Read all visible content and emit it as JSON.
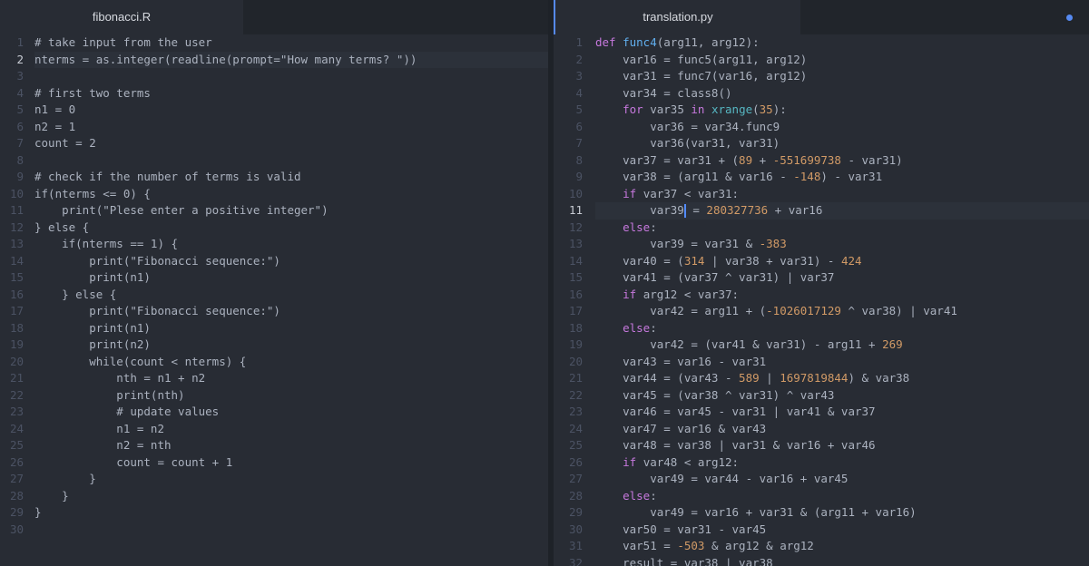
{
  "colors": {
    "background": "#282c34",
    "tabbar": "#21252b",
    "accent": "#568af2",
    "text": "#abb2bf",
    "keyword": "#c678dd",
    "function": "#61afef",
    "number": "#d19a66",
    "builtin": "#56b6c2",
    "line_number": "#4b5263"
  },
  "left": {
    "tab_title": "fibonacci.R",
    "line_numbers": [
      "1",
      "2",
      "3",
      "4",
      "5",
      "6",
      "7",
      "8",
      "9",
      "10",
      "11",
      "12",
      "13",
      "14",
      "15",
      "16",
      "17",
      "18",
      "19",
      "20",
      "21",
      "22",
      "23",
      "24",
      "25",
      "26",
      "27",
      "28",
      "29",
      "30"
    ],
    "lines": [
      "# take input from the user",
      "nterms = as.integer(readline(prompt=\"How many terms? \"))",
      "",
      "# first two terms",
      "n1 = 0",
      "n2 = 1",
      "count = 2",
      "",
      "# check if the number of terms is valid",
      "if(nterms <= 0) {",
      "    print(\"Plese enter a positive integer\")",
      "} else {",
      "    if(nterms == 1) {",
      "        print(\"Fibonacci sequence:\")",
      "        print(n1)",
      "    } else {",
      "        print(\"Fibonacci sequence:\")",
      "        print(n1)",
      "        print(n2)",
      "        while(count < nterms) {",
      "            nth = n1 + n2",
      "            print(nth)",
      "            # update values",
      "            n1 = n2",
      "            n2 = nth",
      "            count = count + 1",
      "        }",
      "    }",
      "}",
      ""
    ]
  },
  "right": {
    "tab_title": "translation.py",
    "line_numbers": [
      "1",
      "2",
      "3",
      "4",
      "5",
      "6",
      "7",
      "8",
      "9",
      "10",
      "11",
      "12",
      "13",
      "14",
      "15",
      "16",
      "17",
      "18",
      "19",
      "20",
      "21",
      "22",
      "23",
      "24",
      "25",
      "26",
      "27",
      "28",
      "29",
      "30",
      "31",
      "32"
    ],
    "lines": [
      "def func4(arg11, arg12):",
      "    var16 = func5(arg11, arg12)",
      "    var31 = func7(var16, arg12)",
      "    var34 = class8()",
      "    for var35 in xrange(35):",
      "        var36 = var34.func9",
      "        var36(var31, var31)",
      "    var37 = var31 + (89 + -551699738 - var31)",
      "    var38 = (arg11 & var16 - -148) - var31",
      "    if var37 < var31:",
      "        var39 = 280327736 + var16",
      "    else:",
      "        var39 = var31 & -383",
      "    var40 = (314 | var38 + var31) - 424",
      "    var41 = (var37 ^ var31) | var37",
      "    if arg12 < var37:",
      "        var42 = arg11 + (-1026017129 ^ var38) | var41",
      "    else:",
      "        var42 = (var41 & var31) - arg11 + 269",
      "    var43 = var16 - var31",
      "    var44 = (var43 - 589 | 1697819844) & var38",
      "    var45 = (var38 ^ var31) ^ var43",
      "    var46 = var45 - var31 | var41 & var37",
      "    var47 = var16 & var43",
      "    var48 = var38 | var31 & var16 + var46",
      "    if var48 < arg12:",
      "        var49 = var44 - var16 + var45",
      "    else:",
      "        var49 = var16 + var31 & (arg11 + var16)",
      "    var50 = var31 - var45",
      "    var51 = -503 & arg12 & arg12",
      "    result = var38 | var38"
    ]
  }
}
